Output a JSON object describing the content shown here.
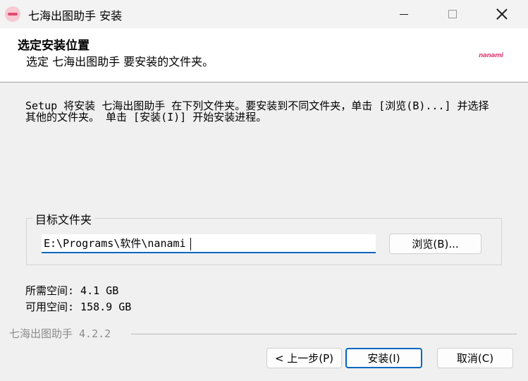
{
  "window": {
    "title": "七海出图助手 安装",
    "icon": "app-logo-icon"
  },
  "header": {
    "title": "选定安装位置",
    "subtitle": "选定 七海出图助手 要安装的文件夹。",
    "logo_text": "nanami"
  },
  "body": {
    "description": "Setup 将安装 七海出图助手 在下列文件夹。要安装到不同文件夹，单击 [浏览(B)...] 并选择其他的文件夹。 单击 [安装(I)] 开始安装进程。",
    "group_label": "目标文件夹",
    "path_value": "E:\\Programs\\软件\\nanami",
    "browse_label": "浏览(B)...",
    "space_required": "所需空间: 4.1 GB",
    "space_available": "可用空间: 158.9 GB"
  },
  "footer": {
    "brand": "七海出图助手 4.2.2",
    "back_label": "< 上一步(P)",
    "install_label": "安装(I)",
    "cancel_label": "取消(C)"
  },
  "colors": {
    "accent": "#0067c0",
    "logo": "#e04b7d"
  }
}
